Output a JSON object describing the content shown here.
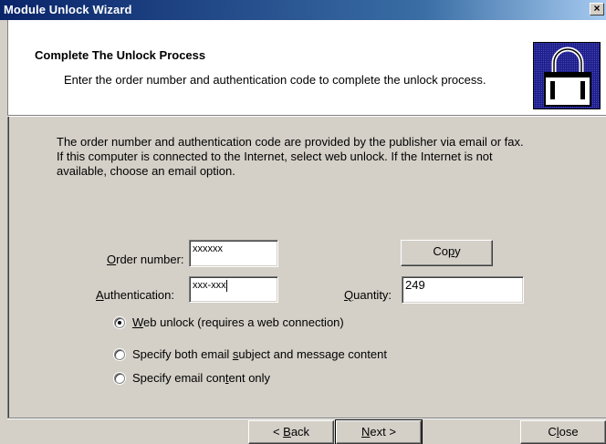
{
  "window": {
    "title": "Module Unlock Wizard",
    "close_glyph": "×"
  },
  "header": {
    "title": "Complete The Unlock Process",
    "subtitle": "Enter the order number and authentication code to complete the unlock process.",
    "icon": "padlock-icon"
  },
  "description": {
    "line1": "The order number and authentication code are provided by the publisher via email or fax.",
    "line2": "If this computer is connected to the Internet, select web unlock.  If the Internet is not",
    "line3": "available, choose an email option."
  },
  "form": {
    "order_number": {
      "label_u": "O",
      "label_rest": "rder number:",
      "value": "xxxxxx"
    },
    "authentication": {
      "label_u": "A",
      "label_rest": "uthentication:",
      "value": "xxx-xxx"
    },
    "quantity": {
      "label_u": "Q",
      "label_rest": "uantity:",
      "value": "249"
    },
    "copy_button": {
      "pre": "Co",
      "u": "p",
      "post": "y"
    }
  },
  "options": [
    {
      "pre": "",
      "u": "W",
      "post": "eb unlock (requires a web connection)",
      "selected": true
    },
    {
      "pre": "Specify both email ",
      "u": "s",
      "post": "ubject and message content",
      "selected": false
    },
    {
      "pre": "Specify email con",
      "u": "t",
      "post": "ent only",
      "selected": false
    }
  ],
  "footer": {
    "back": {
      "pre": "< ",
      "u": "B",
      "post": "ack"
    },
    "next": {
      "pre": "",
      "u": "N",
      "post": "ext >"
    },
    "close": {
      "pre": "C",
      "u": "l",
      "post": "ose"
    }
  }
}
